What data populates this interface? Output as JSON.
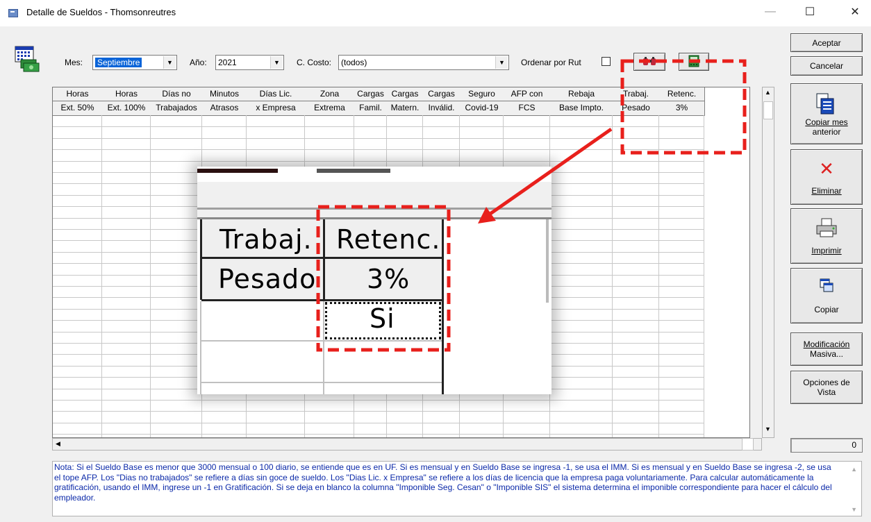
{
  "window": {
    "title": "Detalle de Sueldos - Thomsonreutres",
    "minimize": "—",
    "maximize": "☐",
    "close": "✕"
  },
  "toolbar": {
    "mes_label": "Mes:",
    "mes_value": "Septiembre",
    "anio_label": "Año:",
    "anio_value": "2021",
    "costo_label": "C. Costo:",
    "costo_value": "(todos)",
    "ordenar_label": "Ordenar por Rut"
  },
  "grid": {
    "columns": [
      {
        "l1": "Horas",
        "l2": "Ext. 50%"
      },
      {
        "l1": "Horas",
        "l2": "Ext. 100%"
      },
      {
        "l1": "Días no",
        "l2": "Trabajados"
      },
      {
        "l1": "Minutos",
        "l2": "Atrasos"
      },
      {
        "l1": "Días Lic.",
        "l2": "x Empresa"
      },
      {
        "l1": "Zona",
        "l2": "Extrema"
      },
      {
        "l1": "Cargas",
        "l2": "Famil."
      },
      {
        "l1": "Cargas",
        "l2": "Matern."
      },
      {
        "l1": "Cargas",
        "l2": "Inválid."
      },
      {
        "l1": "Seguro",
        "l2": "Covid-19"
      },
      {
        "l1": "AFP con",
        "l2": "FCS"
      },
      {
        "l1": "Rebaja",
        "l2": "Base Impto."
      },
      {
        "l1": "Trabaj.",
        "l2": "Pesado"
      },
      {
        "l1": "Retenc.",
        "l2": "3%"
      }
    ]
  },
  "zoom": {
    "col1_l1": "Trabaj.",
    "col1_l2": "Pesado",
    "col2_l1": "Retenc.",
    "col2_l2": "3%",
    "cell_value": "Si"
  },
  "buttons": {
    "aceptar": "Aceptar",
    "cancelar": "Cancelar",
    "copiar_mes_a": "Copiar mes",
    "copiar_mes_b": "anterior",
    "eliminar": "Eliminar",
    "imprimir": "Imprimir",
    "copiar": "Copiar",
    "modificacion_a": "Modificación",
    "modificacion_b": "Masiva...",
    "opciones_a": "Opciones de",
    "opciones_b": "Vista"
  },
  "counter": "0",
  "note": "Nota: Si el Sueldo Base es menor que 3000 mensual o 100 diario, se entiende que es en UF. Si es mensual y en Sueldo Base se ingresa -1, se usa el IMM. Si es mensual y en Sueldo Base se ingresa -2, se usa el tope AFP. Los \"Dias no trabajados\" se refiere a días sin goce de sueldo. Los \"Dias Lic. x Empresa\" se refiere a los días de licencia que la empresa paga voluntariamente. Para calcular automáticamente la gratificación, usando el IMM, ingrese un -1 en Gratificación. Si se deja en blanco la columna \"Imponible Seg. Cesan\" o \"Imponible SIS\" el sistema determina el imponible correspondiente para hacer el cálculo del empleador.",
  "colors": {
    "highlight": "#e8201c",
    "note_text": "#0a28a8",
    "selection": "#0a64d8"
  }
}
